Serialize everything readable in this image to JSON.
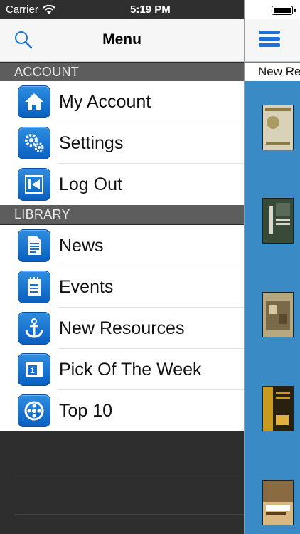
{
  "status_bar": {
    "carrier": "Carrier",
    "time": "5:19 PM"
  },
  "menu": {
    "title": "Menu",
    "sections": [
      {
        "header": "ACCOUNT",
        "items": [
          {
            "label": "My Account",
            "icon": "house-icon"
          },
          {
            "label": "Settings",
            "icon": "gears-icon"
          },
          {
            "label": "Log Out",
            "icon": "logout-icon"
          }
        ]
      },
      {
        "header": "LIBRARY",
        "items": [
          {
            "label": "News",
            "icon": "document-icon"
          },
          {
            "label": "Events",
            "icon": "calendar-icon"
          },
          {
            "label": "New Resources",
            "icon": "anchor-icon"
          },
          {
            "label": "Pick Of The Week",
            "icon": "pick-calendar-icon"
          },
          {
            "label": "Top 10",
            "icon": "film-reel-icon"
          }
        ]
      }
    ]
  },
  "content": {
    "subheader": "New Re",
    "books": [
      {
        "cover_color": "#d8d2b8",
        "accent": "#8a7a40"
      },
      {
        "cover_color": "#3a4a38",
        "accent": "#d8d8d0"
      },
      {
        "cover_color": "#b8a880",
        "accent": "#5a4a30"
      },
      {
        "cover_color": "#c89a20",
        "accent": "#2a2010"
      },
      {
        "cover_color": "#d8b880",
        "accent": "#5a3a20"
      }
    ]
  },
  "colors": {
    "accent": "#1a73d9",
    "section_bg": "#5d5d5d",
    "content_bg": "#3a8bc5"
  }
}
